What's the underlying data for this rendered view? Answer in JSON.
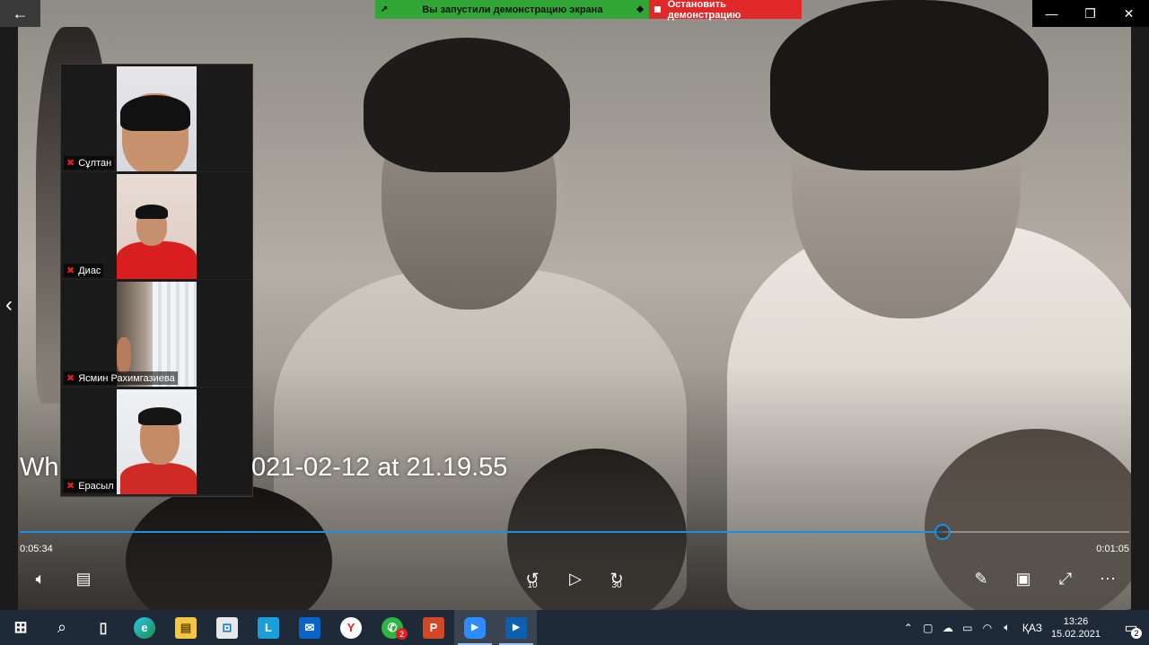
{
  "window": {
    "back_glyph": "←",
    "minimize_glyph": "—",
    "maximize_glyph": "❐",
    "close_glyph": "✕"
  },
  "share_banner": {
    "status_label": "Вы запустили демонстрацию экрана",
    "stop_label": "Остановить демонстрацию",
    "status_color": "#31a637",
    "stop_color": "#e02828"
  },
  "participants": [
    {
      "name": "Сұлтан",
      "muted": true
    },
    {
      "name": "Диас",
      "muted": true
    },
    {
      "name": "Ясмин Рахимгазиева",
      "muted": true
    },
    {
      "name": "Ерасыл",
      "muted": true
    }
  ],
  "player": {
    "title_left": "Wh",
    "title_right": "021-02-12 at 21.19.55",
    "time_elapsed": "0:05:34",
    "time_remaining": "0:01:05",
    "progress_fraction": 0.832,
    "accent_color": "#1e8fe0",
    "skip_back_seconds": "10",
    "skip_forward_seconds": "30"
  },
  "taskbar": {
    "apps": [
      {
        "name": "start-icon",
        "label": "⊞"
      },
      {
        "name": "search-icon",
        "label": "⌕"
      },
      {
        "name": "task-view-icon",
        "label": "▯"
      },
      {
        "name": "edge-icon",
        "label": "e"
      },
      {
        "name": "file-explorer-icon",
        "label": "▤"
      },
      {
        "name": "store-icon",
        "label": "⊡"
      },
      {
        "name": "lingualeo-icon",
        "label": "L"
      },
      {
        "name": "mail-icon",
        "label": "✉"
      },
      {
        "name": "yandex-browser-icon",
        "label": "Y"
      },
      {
        "name": "whatsapp-icon",
        "label": "✆",
        "badge": "2"
      },
      {
        "name": "powerpoint-icon",
        "label": "P"
      },
      {
        "name": "zoom-icon",
        "label": "▶"
      },
      {
        "name": "movies-tv-icon",
        "label": "▶"
      }
    ],
    "language": "ҚАЗ",
    "time": "13:26",
    "date": "15.02.2021",
    "notification_count": "2"
  }
}
